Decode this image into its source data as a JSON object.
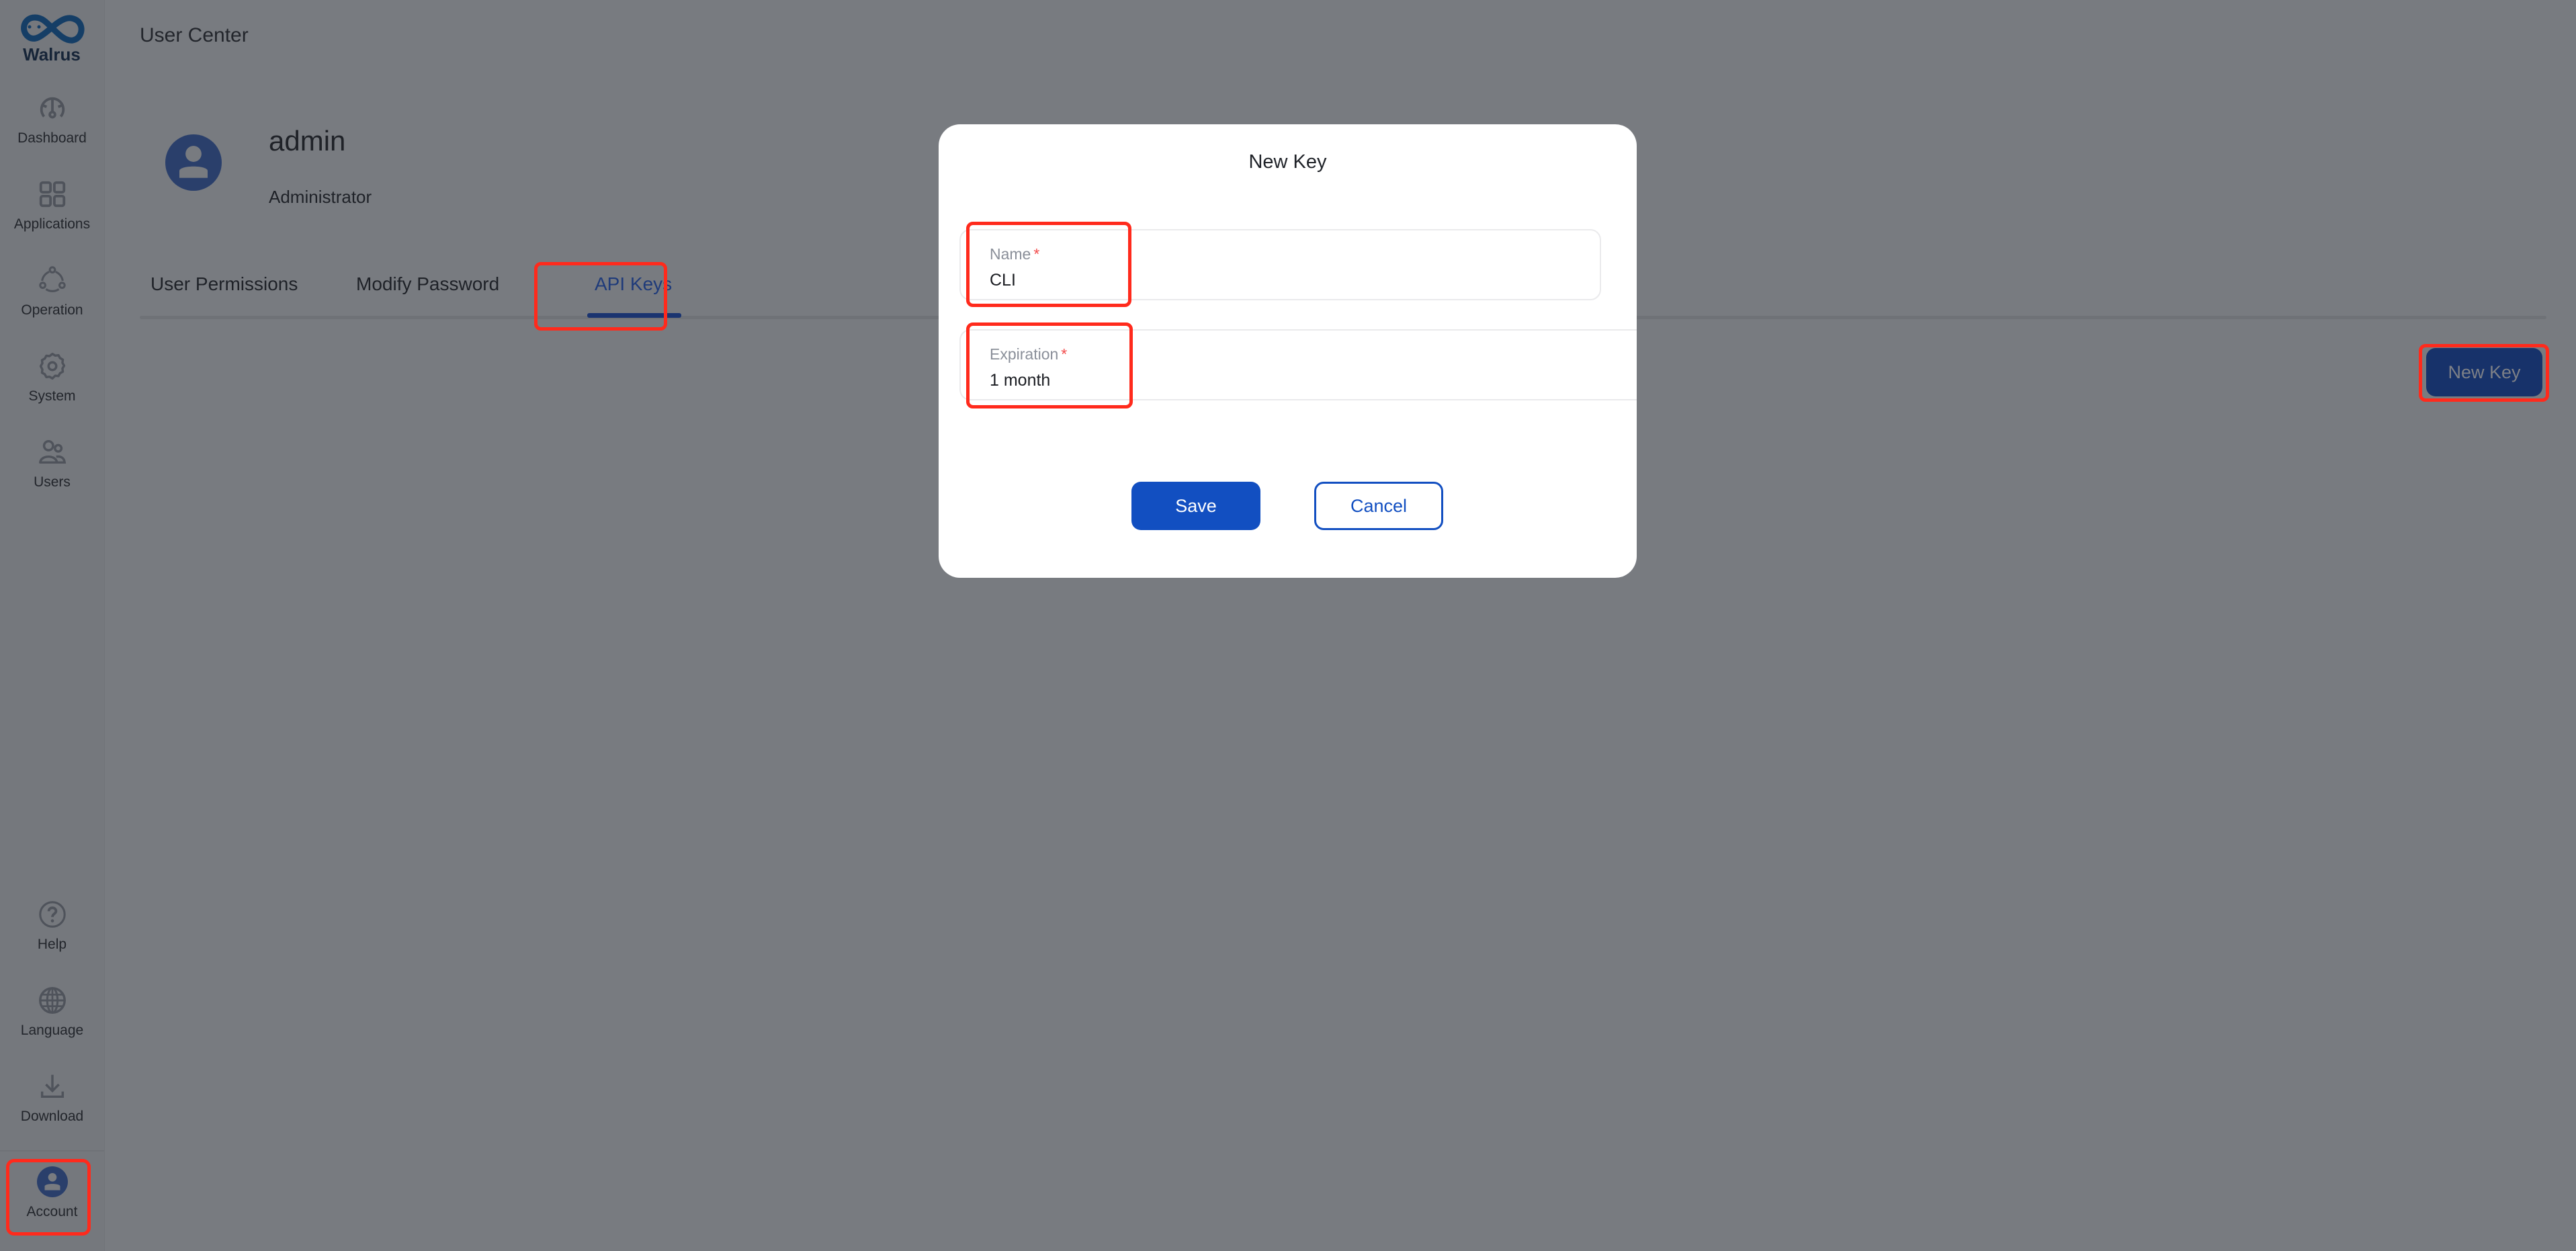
{
  "app": {
    "brand": "Walrus"
  },
  "sidebar": {
    "items": [
      {
        "id": "dashboard",
        "label": "Dashboard",
        "icon": "dashboard-gauge-icon"
      },
      {
        "id": "applications",
        "label": "Applications",
        "icon": "apps-grid-icon"
      },
      {
        "id": "operation",
        "label": "Operation",
        "icon": "operation-cycle-icon"
      },
      {
        "id": "system",
        "label": "System",
        "icon": "gear-icon"
      },
      {
        "id": "users",
        "label": "Users",
        "icon": "users-icon"
      }
    ],
    "bottom_items": [
      {
        "id": "help",
        "label": "Help",
        "icon": "help-circle-icon"
      },
      {
        "id": "language",
        "label": "Language",
        "icon": "globe-icon"
      },
      {
        "id": "download",
        "label": "Download",
        "icon": "download-icon"
      },
      {
        "id": "account",
        "label": "Account",
        "icon": "account-avatar-icon",
        "active": true
      }
    ]
  },
  "header": {
    "title": "User Center"
  },
  "profile": {
    "username": "admin",
    "role": "Administrator"
  },
  "tabs": [
    {
      "label": "User Permissions",
      "active": false
    },
    {
      "label": "Modify Password",
      "active": false
    },
    {
      "label": "API Keys",
      "active": true
    }
  ],
  "toolbar": {
    "new_key_label": "New Key"
  },
  "modal": {
    "title": "New Key",
    "fields": [
      {
        "label": "Name",
        "required_mark": "*",
        "value": "CLI"
      },
      {
        "label": "Expiration",
        "required_mark": "*",
        "value": "1 month"
      }
    ],
    "save_label": "Save",
    "cancel_label": "Cancel"
  },
  "colors": {
    "primary": "#124fc1",
    "brand_dark": "#17326a",
    "highlight": "#ff2a1c",
    "overlay": "#787b80",
    "required": "#f24b4b"
  }
}
